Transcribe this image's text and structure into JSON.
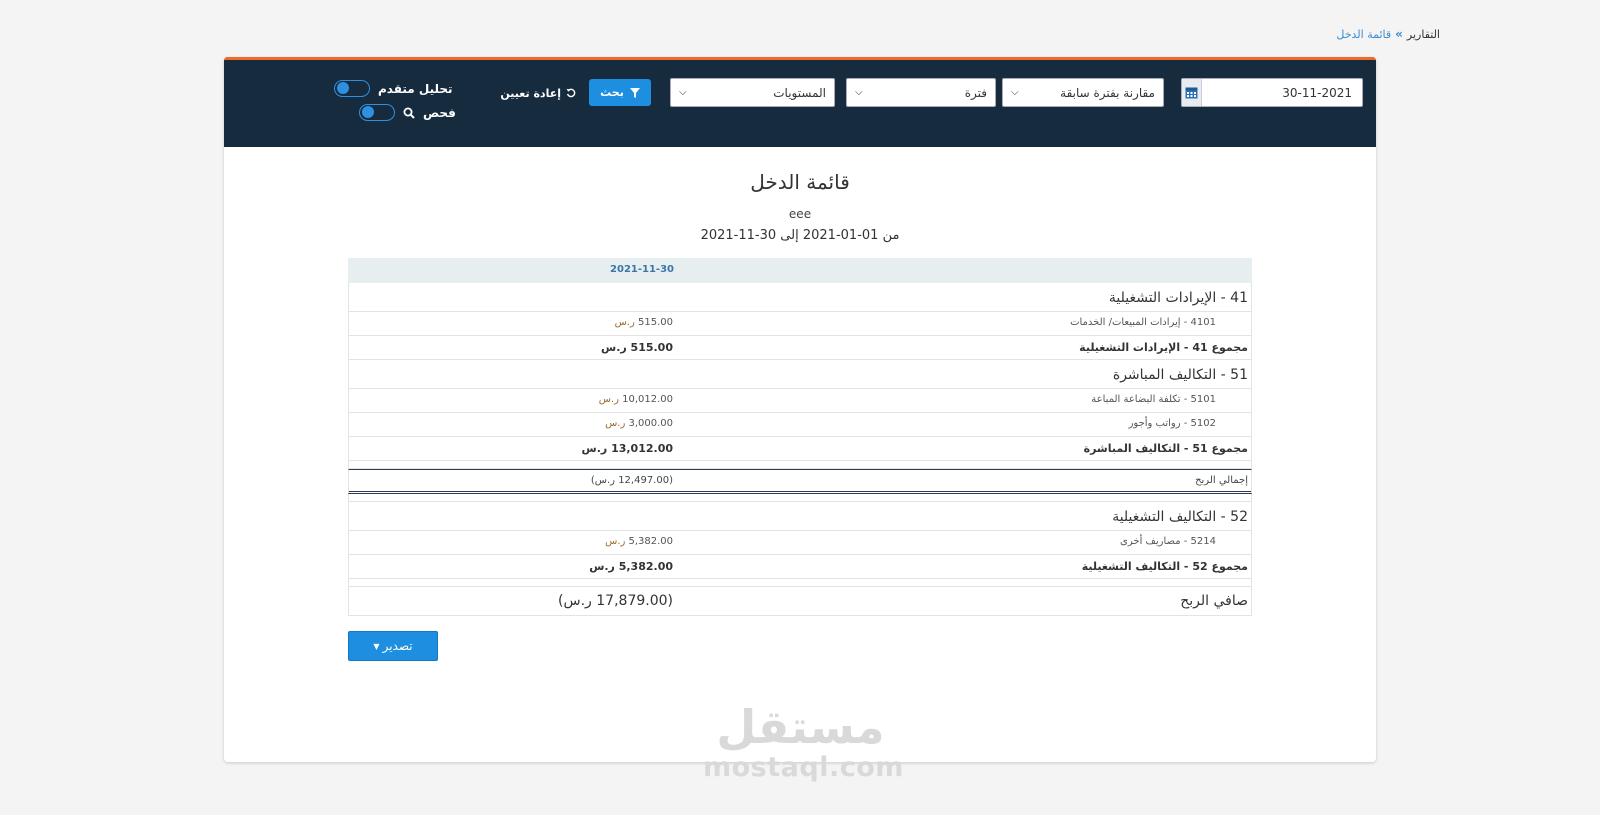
{
  "breadcrumb": {
    "parent": "التقارير",
    "separator": "»",
    "current": "قائمة الدخل"
  },
  "toolbar": {
    "date_value": "30-11-2021",
    "compare_select": "مقارنة بفترة سابقة",
    "period_select": "فترة",
    "levels_select": "المستويات",
    "search_label": "بحث",
    "reset_label": "إعادة تعيين",
    "advanced_label": "تحليل متقدم",
    "inspect_label": "فحص"
  },
  "report": {
    "title": "قائمة الدخل",
    "company": "eee",
    "range": "من 01-01-2021 إلى 30-11-2021",
    "column_date": "2021-11-30",
    "currency": "ر.س",
    "sections": [
      {
        "title": "41 - الإيرادات التشغيلية",
        "items": [
          {
            "label": "4101 - إيرادات المبيعات/ الخدمات",
            "amount": "515.00"
          }
        ],
        "total_label": "مجموع 41 - الإيرادات التشغيلية",
        "total_value": "515.00 ر.س"
      },
      {
        "title": "51 - التكاليف المباشرة",
        "items": [
          {
            "label": "5101 - تكلفة البضاعة المباعة",
            "amount": "10,012.00"
          },
          {
            "label": "5102 - رواتب وأجور",
            "amount": "3,000.00"
          }
        ],
        "total_label": "مجموع 51 - التكاليف المباشرة",
        "total_value": "13,012.00 ر.س"
      },
      {
        "title": "52 - التكاليف التشغيلية",
        "items": [
          {
            "label": "5214 - مصاريف أخرى",
            "amount": "5,382.00"
          }
        ],
        "total_label": "مجموع 52 - التكاليف التشغيلية",
        "total_value": "5,382.00 ر.س"
      }
    ],
    "gross_profit_label": "إجمالي الربح",
    "gross_profit_value": "(12,497.00 ر.س)",
    "net_profit_label": "صافي الربح",
    "net_profit_value": "(17,879.00 ر.س)",
    "export_label": "تصدير"
  },
  "watermark": {
    "arabic": "مستقل",
    "latin": "mostaql.com"
  },
  "colors": {
    "toolbar_bg": "#172b3f",
    "accent_orange": "#f06a2a",
    "primary_blue": "#1e8fe0"
  },
  "icons": [
    "chevrons-right-icon",
    "calendar-icon",
    "filter-icon",
    "undo-icon",
    "search-icon",
    "caret-down-icon"
  ]
}
